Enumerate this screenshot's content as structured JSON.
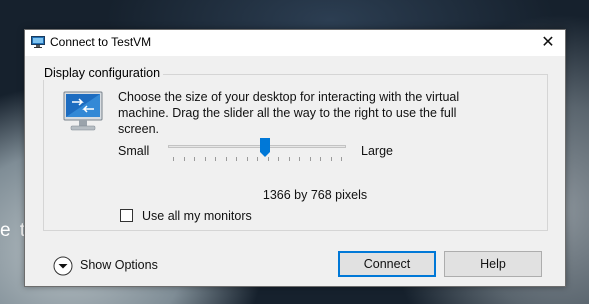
{
  "desktop": {
    "partial_text": "e t"
  },
  "window": {
    "title": "Connect to TestVM",
    "close_glyph": "✕"
  },
  "display": {
    "group_label": "Display configuration",
    "description": "Choose the size of your desktop for interacting with the virtual machine. Drag the slider all the way to the right to use the full screen.",
    "slider": {
      "min_label": "Small",
      "max_label": "Large",
      "position_fraction": 0.55,
      "tick_count": 17
    },
    "resolution_text": "1366 by 768 pixels",
    "monitors_checkbox": {
      "label": "Use all my monitors",
      "checked": false
    }
  },
  "footer": {
    "show_options_label": "Show Options",
    "connect_label": "Connect",
    "help_label": "Help"
  },
  "colors": {
    "accent": "#0078d7",
    "dialog_bg": "#f0f0f0"
  },
  "icons": {
    "app": "remote-desktop-icon",
    "monitor": "monitor-icon",
    "expand": "chevron-down-circle-icon",
    "close": "close-icon"
  }
}
